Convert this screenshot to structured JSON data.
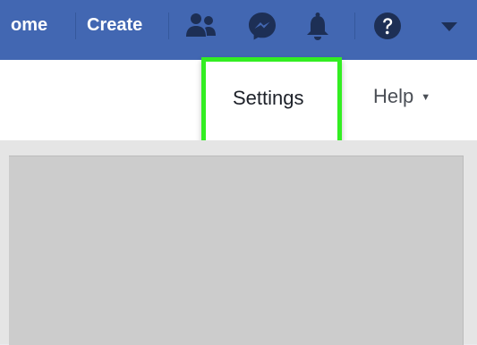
{
  "topbar": {
    "home_label": "ome",
    "create_label": "Create"
  },
  "icons": {
    "friends": "friends-icon",
    "messenger": "messenger-icon",
    "notifications": "bell-icon",
    "help": "help-icon",
    "account_menu": "dropdown-arrow-icon"
  },
  "subbar": {
    "settings_label": "Settings",
    "help_label": "Help",
    "help_caret": "▼"
  },
  "colors": {
    "topbar_bg": "#4267b2",
    "highlight": "#33ee22"
  }
}
